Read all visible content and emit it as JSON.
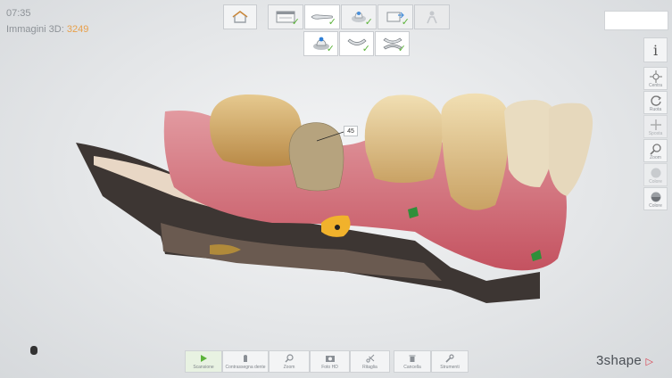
{
  "status": {
    "time": "07:35",
    "images_label": "Immagini 3D:",
    "images_count": "3249"
  },
  "tooth_label": "45",
  "bottom_toolbar": {
    "groups": [
      [
        {
          "label": "Scansione",
          "icon": "play-icon",
          "active": true
        },
        {
          "label": "Contrassegna dente",
          "icon": "tooth-mark-icon"
        },
        {
          "label": "Zoom",
          "icon": "zoom-icon"
        },
        {
          "label": "Foto HD",
          "icon": "camera-icon"
        },
        {
          "label": "Ritaglia",
          "icon": "scissors-icon"
        }
      ],
      [
        {
          "label": "Cancella",
          "icon": "trash-icon"
        },
        {
          "label": "Strumenti",
          "icon": "wrench-icon"
        }
      ]
    ]
  },
  "right_toolbar": {
    "info": {
      "label": "i"
    },
    "items": [
      {
        "label": "Centra",
        "icon": "center-icon"
      },
      {
        "label": "Ruota",
        "icon": "rotate-icon"
      },
      {
        "label": "Sposta",
        "icon": "move-icon",
        "disabled": true
      },
      {
        "label": "Zoom",
        "icon": "zoom-icon"
      },
      {
        "label": "Colore",
        "icon": "color-sphere-icon",
        "disabled": true
      },
      {
        "label": "Colore",
        "icon": "color-sphere-icon"
      }
    ]
  },
  "logo": {
    "text": "3shape"
  },
  "colors": {
    "accent_orange": "#e8a04a",
    "check_green": "#5cb33a",
    "logo_red": "#d9414f"
  }
}
